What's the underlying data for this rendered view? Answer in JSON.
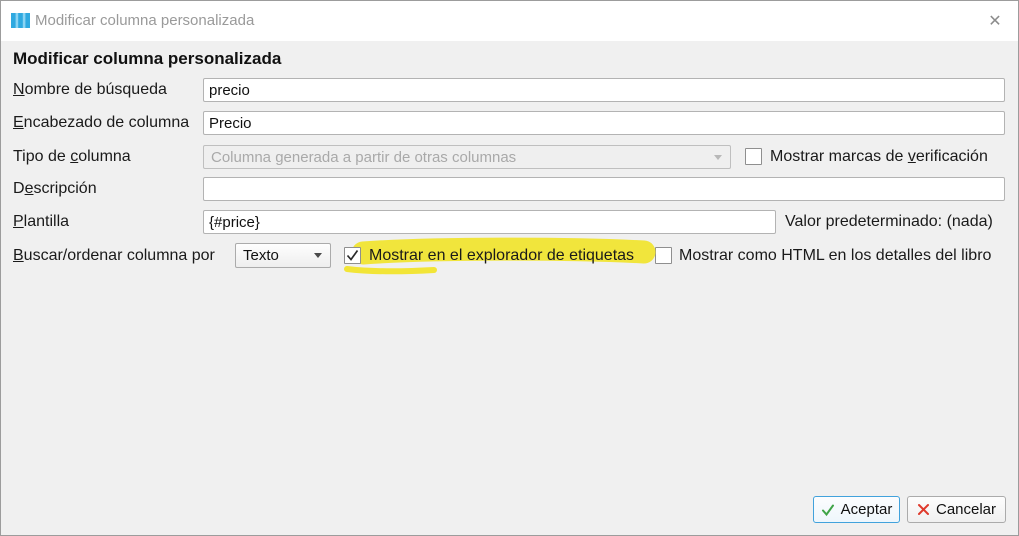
{
  "window": {
    "title": "Modificar columna personalizada"
  },
  "icons": {
    "close": "✕"
  },
  "heading": "Modificar columna personalizada",
  "form": {
    "lookup_name": {
      "label_key": "N",
      "label_post": "ombre de búsqueda",
      "value": "precio"
    },
    "column_heading": {
      "label_key": "E",
      "label_post": "ncabezado de columna",
      "value": "Precio"
    },
    "column_type": {
      "label_pre": "Tipo de ",
      "label_key": "c",
      "label_post": "olumna",
      "value": "Columna generada a partir de otras columnas",
      "disabled": true
    },
    "show_checkmarks": {
      "label_pre": "Mostrar marcas de ",
      "label_key": "v",
      "label_post": "erificación",
      "checked": false
    },
    "description": {
      "label_pre": "D",
      "label_key": "e",
      "label_post": "scripción",
      "value": ""
    },
    "template": {
      "label_key": "P",
      "label_post": "lantilla",
      "value": "{#price}",
      "default_value_text": "Valor predeterminado: (nada)"
    },
    "sort_by": {
      "label_key": "B",
      "label_post": "uscar/ordenar columna por",
      "value": "Texto"
    },
    "show_in_tag_browser": {
      "label": "Mostrar en el explorador de etiquetas",
      "checked": true,
      "highlighted": true
    },
    "show_as_html": {
      "label": "Mostrar como HTML en los detalles del libro",
      "checked": false
    }
  },
  "buttons": {
    "accept": "Aceptar",
    "cancel": "Cancelar"
  },
  "colors": {
    "icon_blue": "#2fa9e0",
    "icon_blue_light": "#8bd4f3",
    "highlight_yellow": "#f1e42c",
    "check_green": "#3fa447",
    "checkbox_check": "#2a2a2a",
    "cancel_red": "#df3a2c",
    "accept_border": "#41a2dc",
    "titlebar_bg": "#ffffff",
    "dialog_bg": "#f0f0f0"
  }
}
